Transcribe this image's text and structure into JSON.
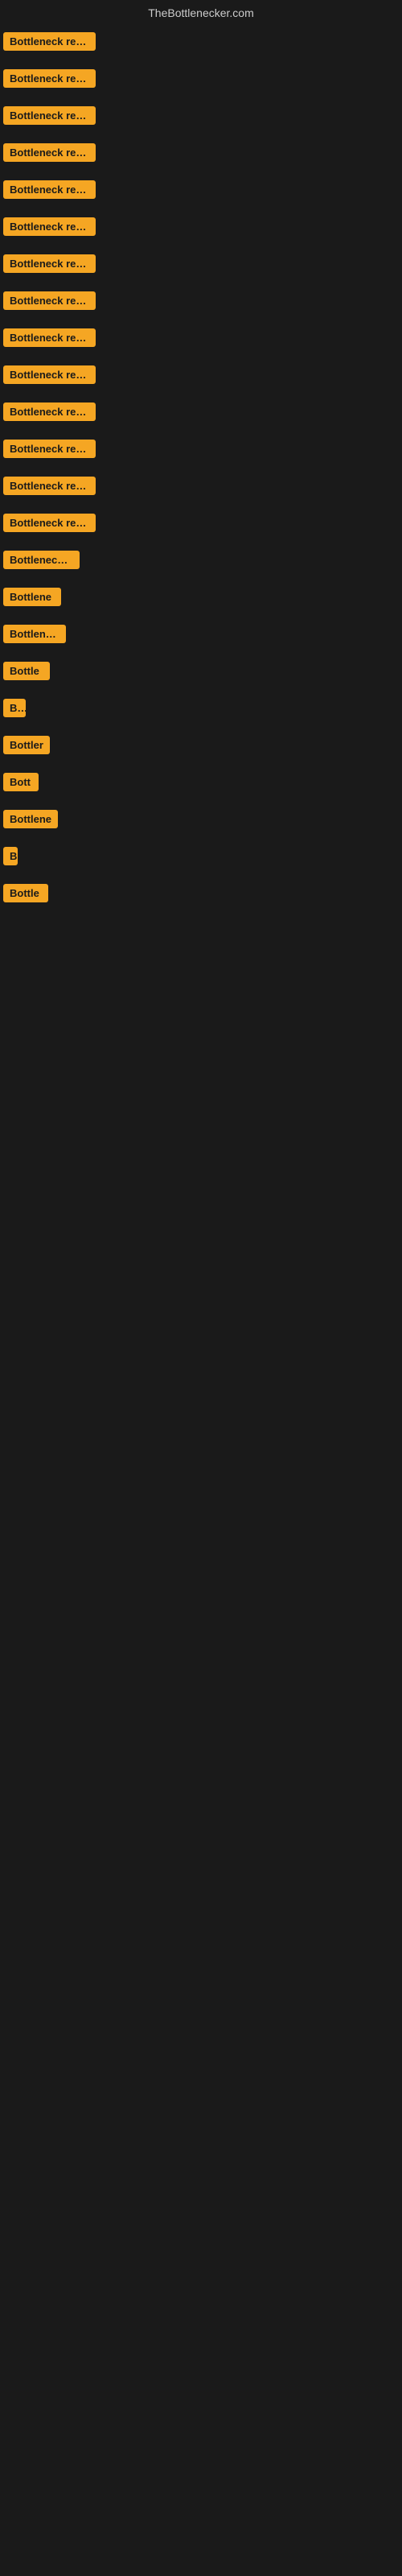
{
  "header": {
    "title": "TheBottlenecker.com"
  },
  "badges": [
    {
      "id": 1,
      "label": "Bottleneck result",
      "width": 115
    },
    {
      "id": 2,
      "label": "Bottleneck result",
      "width": 115
    },
    {
      "id": 3,
      "label": "Bottleneck result",
      "width": 115
    },
    {
      "id": 4,
      "label": "Bottleneck result",
      "width": 115
    },
    {
      "id": 5,
      "label": "Bottleneck result",
      "width": 115
    },
    {
      "id": 6,
      "label": "Bottleneck result",
      "width": 115
    },
    {
      "id": 7,
      "label": "Bottleneck result",
      "width": 115
    },
    {
      "id": 8,
      "label": "Bottleneck result",
      "width": 115
    },
    {
      "id": 9,
      "label": "Bottleneck result",
      "width": 115
    },
    {
      "id": 10,
      "label": "Bottleneck result",
      "width": 115
    },
    {
      "id": 11,
      "label": "Bottleneck result",
      "width": 115
    },
    {
      "id": 12,
      "label": "Bottleneck result",
      "width": 115
    },
    {
      "id": 13,
      "label": "Bottleneck result",
      "width": 115
    },
    {
      "id": 14,
      "label": "Bottleneck result",
      "width": 115
    },
    {
      "id": 15,
      "label": "Bottleneck re",
      "width": 95
    },
    {
      "id": 16,
      "label": "Bottlene",
      "width": 72
    },
    {
      "id": 17,
      "label": "Bottleneck",
      "width": 78
    },
    {
      "id": 18,
      "label": "Bottle",
      "width": 58
    },
    {
      "id": 19,
      "label": "Bo",
      "width": 28
    },
    {
      "id": 20,
      "label": "Bottler",
      "width": 58
    },
    {
      "id": 21,
      "label": "Bott",
      "width": 44
    },
    {
      "id": 22,
      "label": "Bottlene",
      "width": 68
    },
    {
      "id": 23,
      "label": "B",
      "width": 18
    },
    {
      "id": 24,
      "label": "Bottle",
      "width": 56
    }
  ]
}
